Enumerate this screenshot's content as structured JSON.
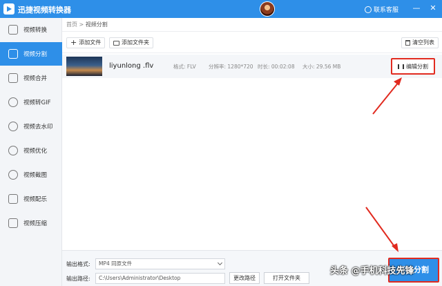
{
  "app": {
    "title": "迅捷视频转换器",
    "support": "联系客服",
    "minimize": "—",
    "close": "✕"
  },
  "sidebar": {
    "items": [
      {
        "label": "视频转换",
        "icon": "convert-icon",
        "active": false
      },
      {
        "label": "视频分割",
        "icon": "split-icon",
        "active": true
      },
      {
        "label": "视频合并",
        "icon": "merge-icon",
        "active": false
      },
      {
        "label": "视频转GIF",
        "icon": "gif-icon",
        "active": false
      },
      {
        "label": "视频去水印",
        "icon": "watermark-icon",
        "active": false
      },
      {
        "label": "视频优化",
        "icon": "optimize-icon",
        "active": false
      },
      {
        "label": "视频截图",
        "icon": "screenshot-icon",
        "active": false
      },
      {
        "label": "视频配乐",
        "icon": "music-icon",
        "active": false
      },
      {
        "label": "视频压缩",
        "icon": "compress-icon",
        "active": false
      }
    ]
  },
  "breadcrumb": {
    "home": "首页",
    "sep": ">",
    "current": "视频分割"
  },
  "toolbar": {
    "add_file": "添加文件",
    "add_folder": "添加文件夹",
    "clear_list": "清空列表"
  },
  "file": {
    "name": "liyunlong .flv",
    "format": "格式: FLV",
    "resolution": "分辨率: 1280*720",
    "duration": "时长: 00:02:08",
    "size": "大小: 29.56 MB",
    "edit_label": "编辑分割"
  },
  "bottom": {
    "format_label": "输出格式:",
    "format_value": "MP4  同原文件",
    "path_label": "输出路径:",
    "path_value": "C:\\Users\\Administrator\\Desktop",
    "change_path": "更改路径",
    "open_folder": "打开文件夹",
    "start": "开始分割"
  },
  "watermark": "头条 @手机科技先锋",
  "colors": {
    "accent": "#2e8fe8",
    "highlight": "#e12a1f"
  }
}
